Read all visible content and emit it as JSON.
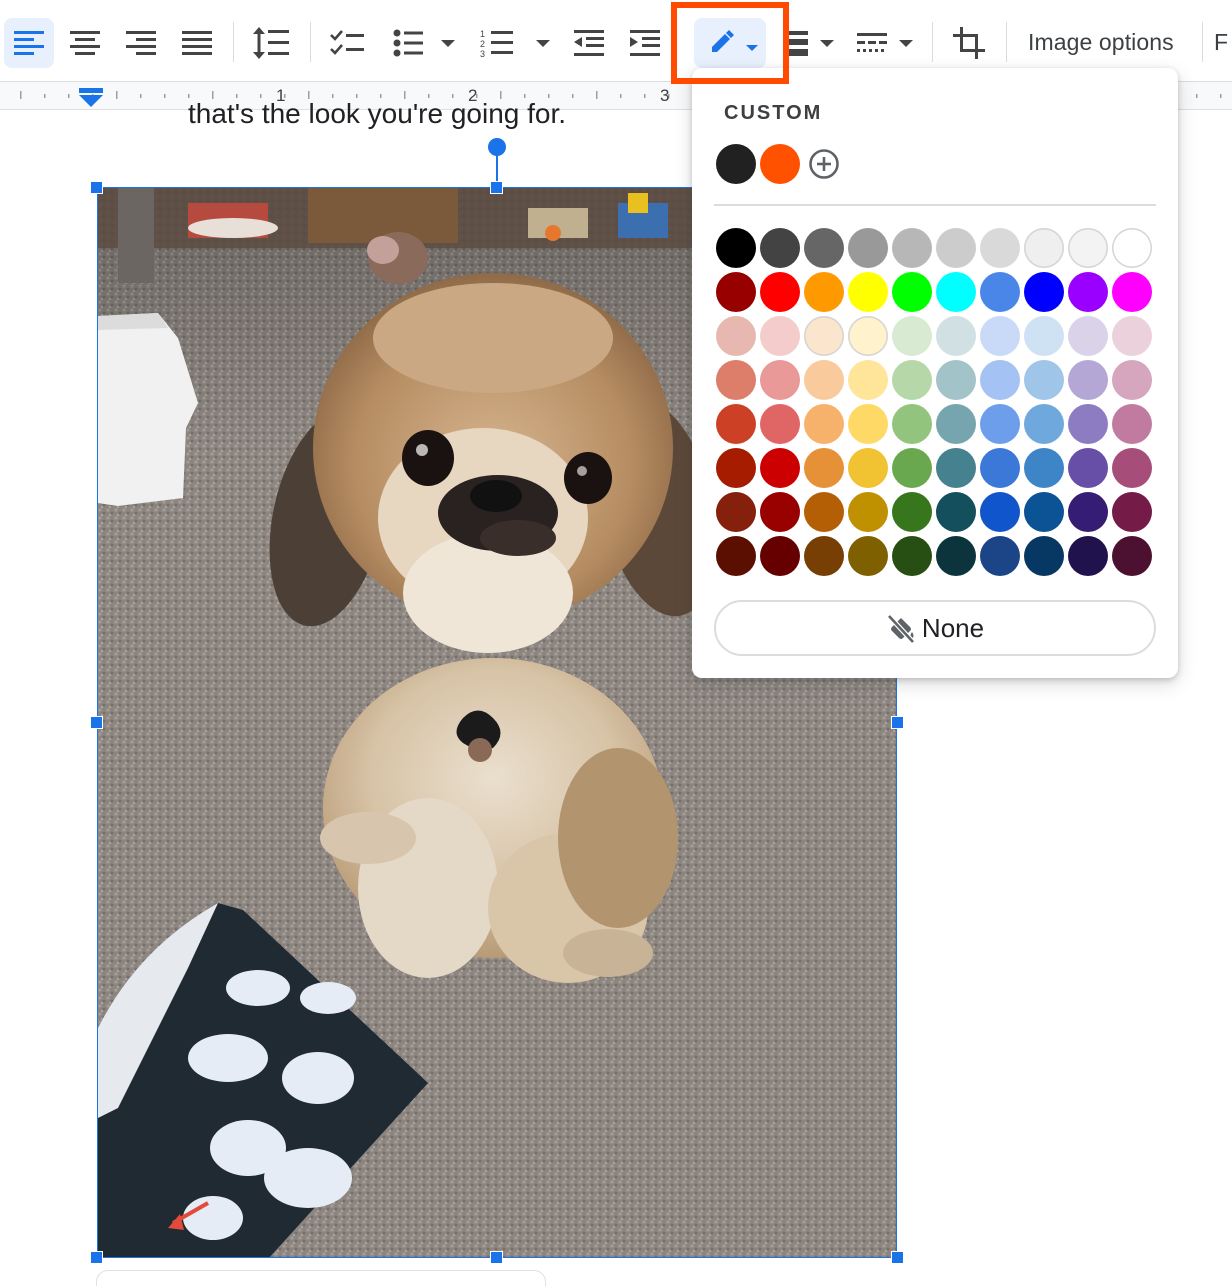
{
  "toolbar": {
    "image_options_label": "Image options",
    "cut_label": "F",
    "buttons": [
      {
        "name": "align-left",
        "active": true
      },
      {
        "name": "align-center",
        "active": false
      },
      {
        "name": "align-right",
        "active": false
      },
      {
        "name": "align-justify",
        "active": false
      },
      {
        "name": "line-spacing",
        "active": false
      },
      {
        "name": "checklist",
        "active": false
      },
      {
        "name": "bulleted-list",
        "active": false
      },
      {
        "name": "numbered-list",
        "active": false
      },
      {
        "name": "decrease-indent",
        "active": false
      },
      {
        "name": "increase-indent",
        "active": false
      },
      {
        "name": "border-color",
        "active": true
      },
      {
        "name": "border-weight",
        "active": false
      },
      {
        "name": "border-dash",
        "active": false
      },
      {
        "name": "crop-image",
        "active": false
      }
    ],
    "highlight_color": "#ff4a00"
  },
  "ruler": {
    "numbers": [
      "1",
      "2",
      "3"
    ]
  },
  "document": {
    "text_line": "that's the look you're going for."
  },
  "color_menu": {
    "custom_label": "CUSTOM",
    "custom_colors": [
      "#212121",
      "#ff5100"
    ],
    "add_custom_icon": "plus-circle-icon",
    "palette": [
      [
        "#000000",
        "#434343",
        "#666666",
        "#999999",
        "#b7b7b7",
        "#cccccc",
        "#d9d9d9",
        "#efefef",
        "#f3f3f3",
        "#ffffff"
      ],
      [
        "#980000",
        "#ff0000",
        "#ff9900",
        "#ffff00",
        "#00ff00",
        "#00ffff",
        "#4a86e8",
        "#0000ff",
        "#9900ff",
        "#ff00ff"
      ],
      [
        "#e6b8af",
        "#f4cccc",
        "#fce5cd",
        "#fff2cc",
        "#d9ead3",
        "#d0e0e3",
        "#c9daf8",
        "#cfe2f3",
        "#d9d2e9",
        "#ead1dc"
      ],
      [
        "#dd7e6b",
        "#ea9999",
        "#f9cb9c",
        "#ffe599",
        "#b6d7a8",
        "#a2c4c9",
        "#a4c2f4",
        "#9fc5e8",
        "#b4a7d6",
        "#d5a6bd"
      ],
      [
        "#cc4125",
        "#e06666",
        "#f6b26b",
        "#ffd966",
        "#93c47d",
        "#76a5af",
        "#6d9eeb",
        "#6fa8dc",
        "#8e7cc3",
        "#c27ba0"
      ],
      [
        "#a61c00",
        "#cc0000",
        "#e69138",
        "#f1c232",
        "#6aa84f",
        "#45818e",
        "#3c78d8",
        "#3d85c6",
        "#674ea7",
        "#a64d79"
      ],
      [
        "#85200c",
        "#990000",
        "#b45f06",
        "#bf9000",
        "#38761d",
        "#134f5c",
        "#1155cc",
        "#0b5394",
        "#351c75",
        "#741b47"
      ],
      [
        "#5b0f00",
        "#660000",
        "#783f04",
        "#7f6000",
        "#274e13",
        "#0c343d",
        "#1c4587",
        "#073763",
        "#20124d",
        "#4c1130"
      ]
    ],
    "none_label": "None",
    "none_icon": "no-color-icon"
  },
  "image": {
    "alt": "Pekingese dog sitting on carpet"
  }
}
